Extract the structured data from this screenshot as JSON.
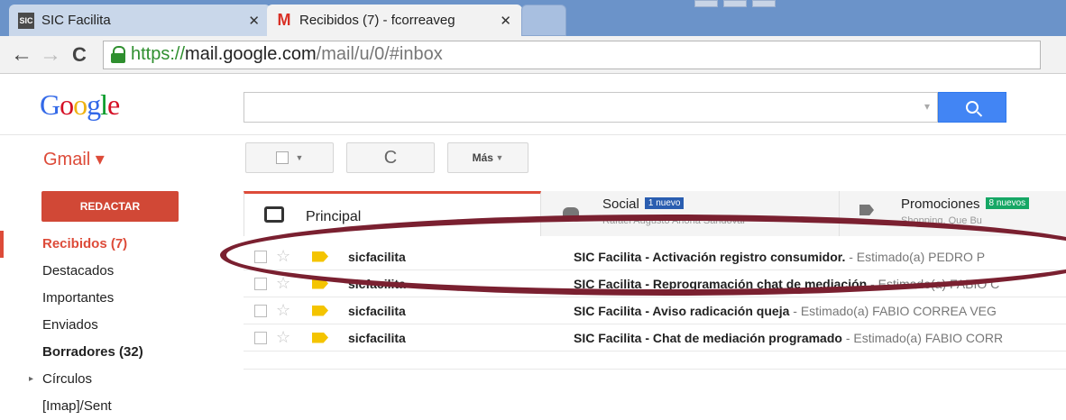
{
  "browser": {
    "tabs": [
      {
        "title": "SIC Facilita",
        "favicon": "sic-favicon-icon",
        "favicon_text": "SIC\nf"
      },
      {
        "title": "Recibidos (7) - fcorreaveg",
        "favicon": "gmail-favicon-icon",
        "favicon_text": "M"
      }
    ],
    "url": {
      "scheme": "https://",
      "host": "mail.google.com",
      "path": "/mail/u/0/#inbox"
    }
  },
  "header": {
    "logo_letters": [
      {
        "ch": "G",
        "color": "#3369e8"
      },
      {
        "ch": "o",
        "color": "#d50f25"
      },
      {
        "ch": "o",
        "color": "#eeb211"
      },
      {
        "ch": "g",
        "color": "#3369e8"
      },
      {
        "ch": "l",
        "color": "#009925"
      },
      {
        "ch": "e",
        "color": "#d50f25"
      }
    ],
    "gmail_label": "Gmail ▾"
  },
  "actions": {
    "more_label": "Más"
  },
  "sidebar": {
    "compose_label": "REDACTAR",
    "items": [
      {
        "label": "Recibidos (7)",
        "state": "active"
      },
      {
        "label": "Destacados",
        "state": ""
      },
      {
        "label": "Importantes",
        "state": ""
      },
      {
        "label": "Enviados",
        "state": ""
      },
      {
        "label": "Borradores (32)",
        "state": "bold"
      },
      {
        "label": "Círculos",
        "state": "expandable"
      },
      {
        "label": "[Imap]/Sent",
        "state": ""
      }
    ]
  },
  "categories": {
    "principal": "Principal",
    "social": {
      "name": "Social",
      "badge": "1 nuevo",
      "sub": "Rafael Augusto Ariona Sandoval"
    },
    "promos": {
      "name": "Promociones",
      "badge": "8 nuevos",
      "sub": "Shopping, Que Bu"
    }
  },
  "emails": [
    {
      "sender": "sicfacilita",
      "subject": "SIC Facilita - Activación registro consumidor.",
      "snippet": " - Estimado(a) PEDRO P"
    },
    {
      "sender": "sicfacilita",
      "subject": "SIC Facilita - Reprogramación chat de mediación",
      "snippet": " - Estimado(a) FABIO C"
    },
    {
      "sender": "sicfacilita",
      "subject": "SIC Facilita - Aviso radicación queja",
      "snippet": " - Estimado(a) FABIO CORREA VEG"
    },
    {
      "sender": "sicfacilita",
      "subject": "SIC Facilita - Chat de mediación programado",
      "snippet": " - Estimado(a) FABIO CORR"
    }
  ],
  "colors": {
    "accent": "#dd4b39",
    "highlight_oval": "#7a2030",
    "search_button": "#4285f4"
  }
}
